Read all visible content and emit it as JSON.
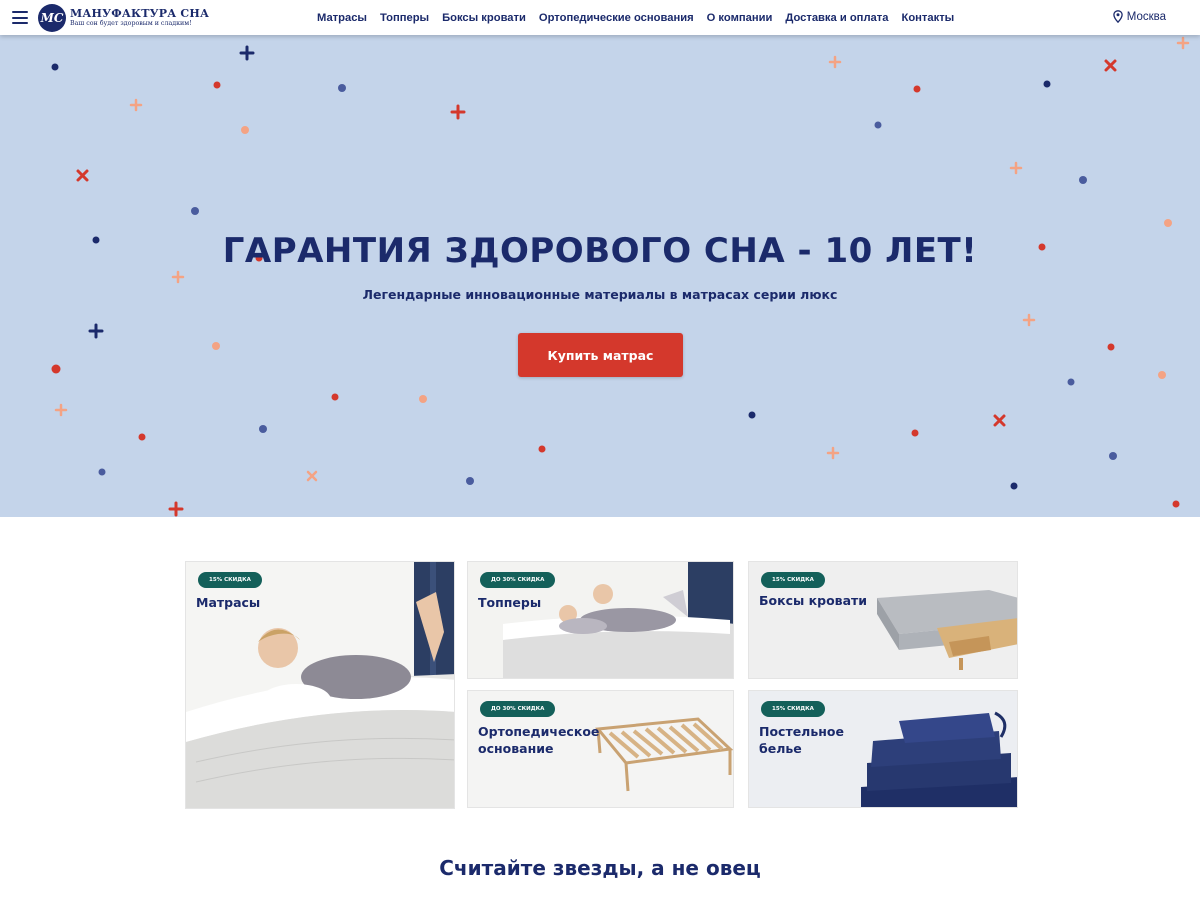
{
  "header": {
    "logo": {
      "mark": "МС",
      "title": "МАНУФАКТУРА СНА",
      "tagline": "Ваш сон будет здоровым и сладким!"
    },
    "nav": [
      "Матрасы",
      "Топперы",
      "Боксы кровати",
      "Ортопедические основания",
      "О компании",
      "Доставка и оплата",
      "Контакты"
    ],
    "city": "Москва",
    "icons": {
      "menu": "hamburger-icon",
      "city": "location-pin-icon"
    }
  },
  "hero": {
    "title": "ГАРАНТИЯ ЗДОРОВОГО СНА - 10 ЛЕТ!",
    "subtitle": "Легендарные инновационные материалы в матрасах серии люкс",
    "button": "Купить матрас",
    "colors": {
      "background": "#c4d4ea",
      "accent": "#d4382c",
      "navy": "#1b2a6b",
      "peach": "#f4a384"
    }
  },
  "categories": [
    {
      "badge": "15% СКИДКА",
      "title": "Матрасы"
    },
    {
      "badge": "ДО 30% СКИДКА",
      "title": "Топперы"
    },
    {
      "badge": "15% СКИДКА",
      "title": "Боксы кровати"
    },
    {
      "badge": "ДО 30% СКИДКА",
      "title": "Ортопедическое основание"
    },
    {
      "badge": "15% СКИДКА",
      "title": "Постельное белье"
    }
  ],
  "section_title": "Считайте звезды, а не овец"
}
